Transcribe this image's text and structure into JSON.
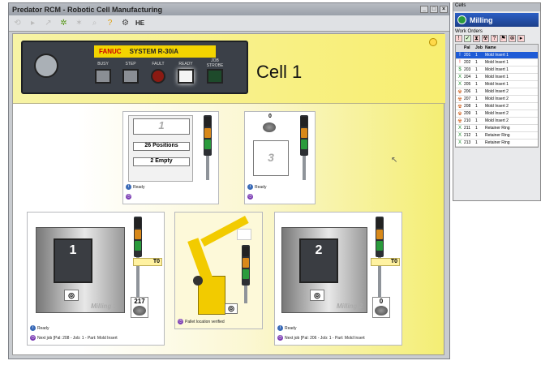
{
  "window": {
    "title": "Predator RCM - Robotic Cell Manufacturing",
    "buttons": [
      "_",
      "□",
      "×"
    ]
  },
  "toolbar": {
    "label": "HE"
  },
  "panel": {
    "brand": "FANUC",
    "system": "SYSTEM R-30iA",
    "labels": [
      "BUSY",
      "STEP",
      "FAULT",
      "READY",
      "JOB STROBE"
    ]
  },
  "cell": {
    "title": "Cell 1"
  },
  "rack": {
    "number": "1",
    "positions": "26 Positions",
    "empty": "2 Empty",
    "status": "Ready"
  },
  "station": {
    "count": "0",
    "number": "3",
    "status": "Ready"
  },
  "machine1": {
    "number": "1",
    "name": "Milling 1",
    "tool": "T0",
    "count": "217",
    "status": "Ready",
    "job": "Next job [Pal: 208 - Job: 1 - Part: Mold Insert"
  },
  "robot": {
    "status": "Pallet location verified"
  },
  "machine2": {
    "number": "2",
    "name": "Milling 2",
    "tool": "T0",
    "count": "0",
    "status": "Ready",
    "job": "Next job [Pal: 206 - Job: 1 - Part: Mold Insert"
  },
  "sidepanel": {
    "title": "Cells",
    "cell_name": "Milling",
    "orders_title": "Work Orders",
    "columns": [
      "",
      "Pal",
      "Job",
      "Name"
    ],
    "rows": [
      {
        "icon": "!",
        "pal": "201",
        "job": "1",
        "name": "Mold Insert 1"
      },
      {
        "icon": "!",
        "pal": "202",
        "job": "1",
        "name": "Mold Insert 1"
      },
      {
        "icon": "$",
        "pal": "203",
        "job": "1",
        "name": "Mold Insert 1"
      },
      {
        "icon": "X",
        "pal": "204",
        "job": "1",
        "name": "Mold Insert 1"
      },
      {
        "icon": "X",
        "pal": "205",
        "job": "1",
        "name": "Mold Insert 1"
      },
      {
        "icon": "☢",
        "pal": "206",
        "job": "1",
        "name": "Mold Insert 2"
      },
      {
        "icon": "☢",
        "pal": "207",
        "job": "1",
        "name": "Mold Insert 2"
      },
      {
        "icon": "☢",
        "pal": "208",
        "job": "1",
        "name": "Mold Insert 2"
      },
      {
        "icon": "☢",
        "pal": "209",
        "job": "1",
        "name": "Mold Insert 2"
      },
      {
        "icon": "☢",
        "pal": "210",
        "job": "1",
        "name": "Mold Insert 2"
      },
      {
        "icon": "X",
        "pal": "211",
        "job": "1",
        "name": "Retainer Ring"
      },
      {
        "icon": "X",
        "pal": "212",
        "job": "1",
        "name": "Retainer Ring"
      },
      {
        "icon": "X",
        "pal": "213",
        "job": "1",
        "name": "Retainer Ring"
      }
    ]
  }
}
